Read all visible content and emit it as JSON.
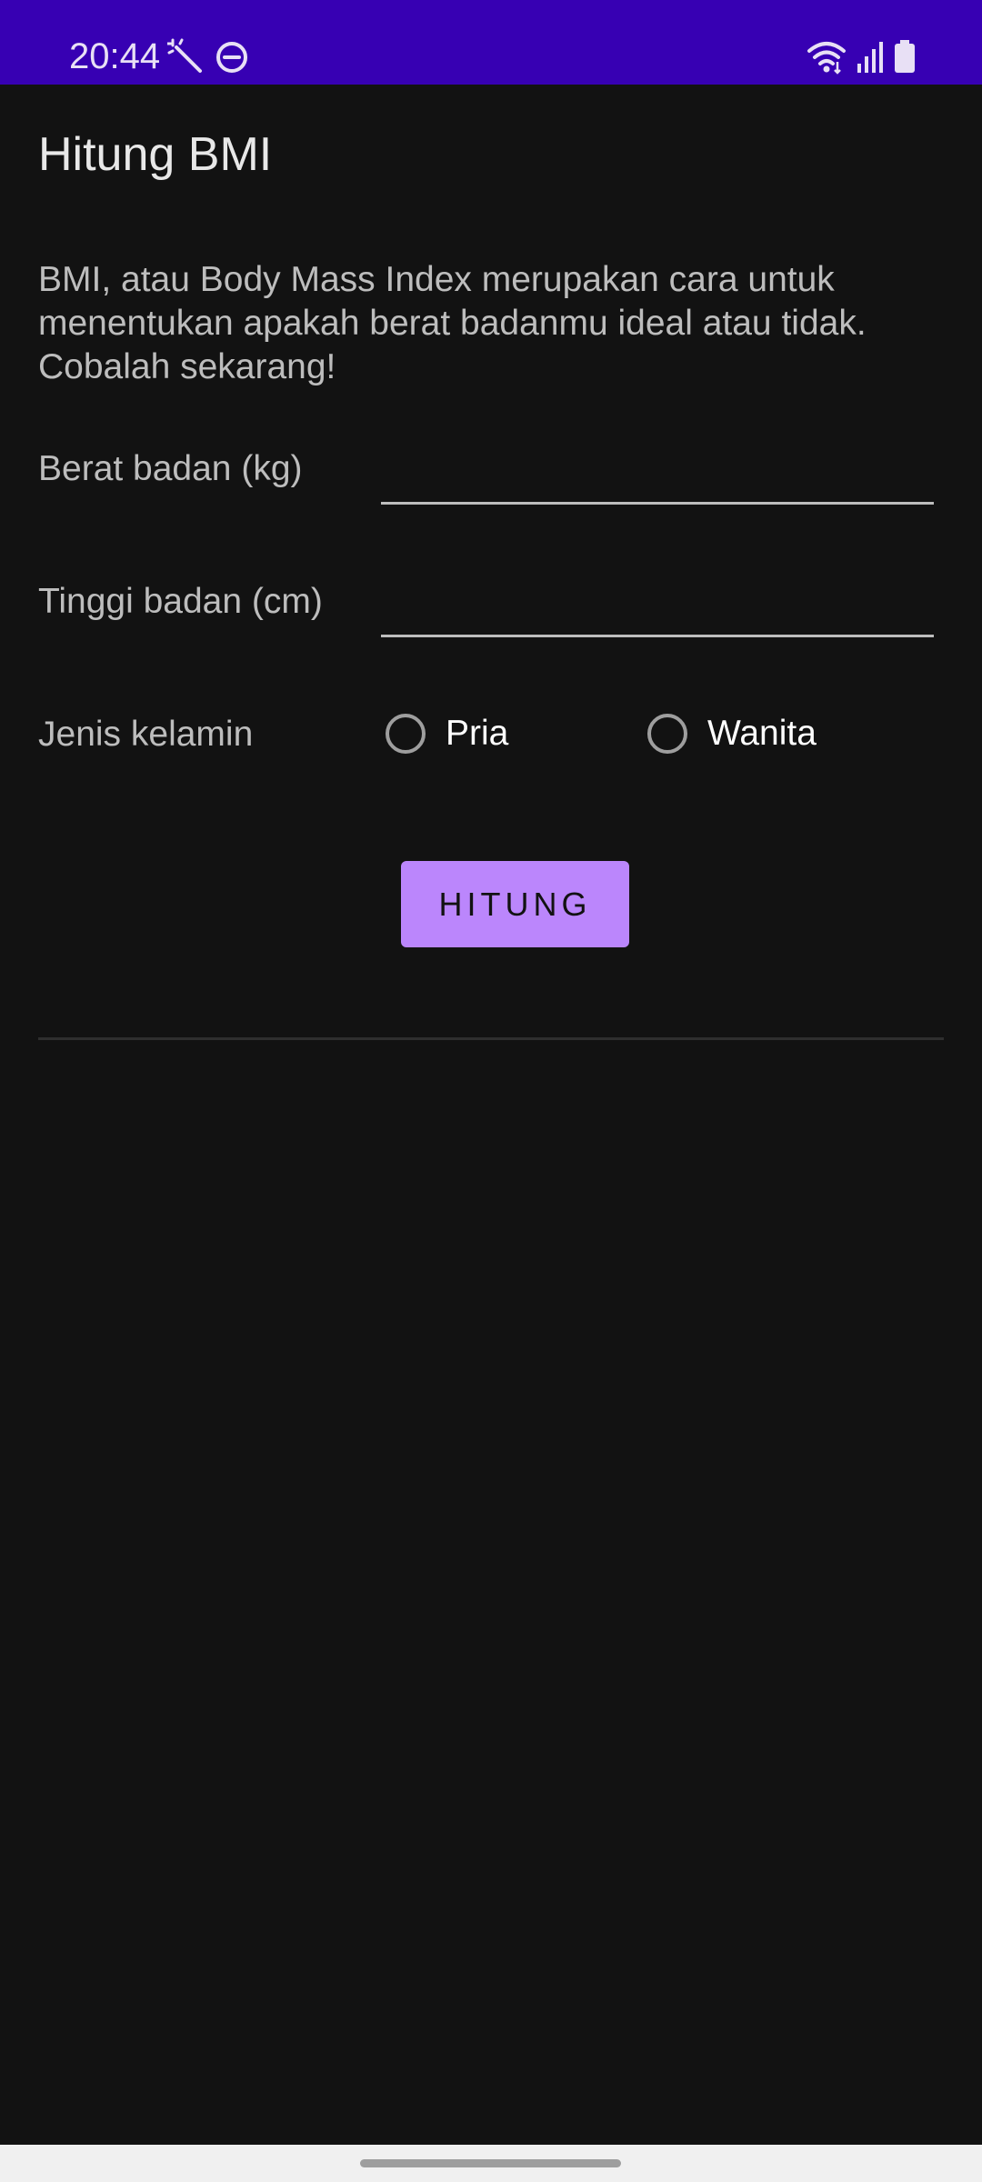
{
  "status_bar": {
    "time": "20:44",
    "left_icons": [
      "magic-wand-icon",
      "do-not-disturb-icon"
    ],
    "right_icons": [
      "wifi-icon",
      "cell-signal-icon",
      "battery-icon"
    ],
    "background_color": "#3700B3"
  },
  "app": {
    "title": "Hitung BMI",
    "description": "BMI, atau Body Mass Index merupakan cara untuk menentukan apakah berat badanmu ideal atau tidak. Cobalah sekarang!"
  },
  "form": {
    "weight_label": "Berat badan (kg)",
    "weight_value": "",
    "height_label": "Tinggi badan (cm)",
    "height_value": "",
    "gender_label": "Jenis kelamin",
    "gender_options": [
      "Pria",
      "Wanita"
    ],
    "selected_gender": null,
    "calculate_label": "HITUNG"
  },
  "colors": {
    "background": "#121212",
    "accent": "#BB86FC",
    "status_bar": "#3700B3"
  }
}
